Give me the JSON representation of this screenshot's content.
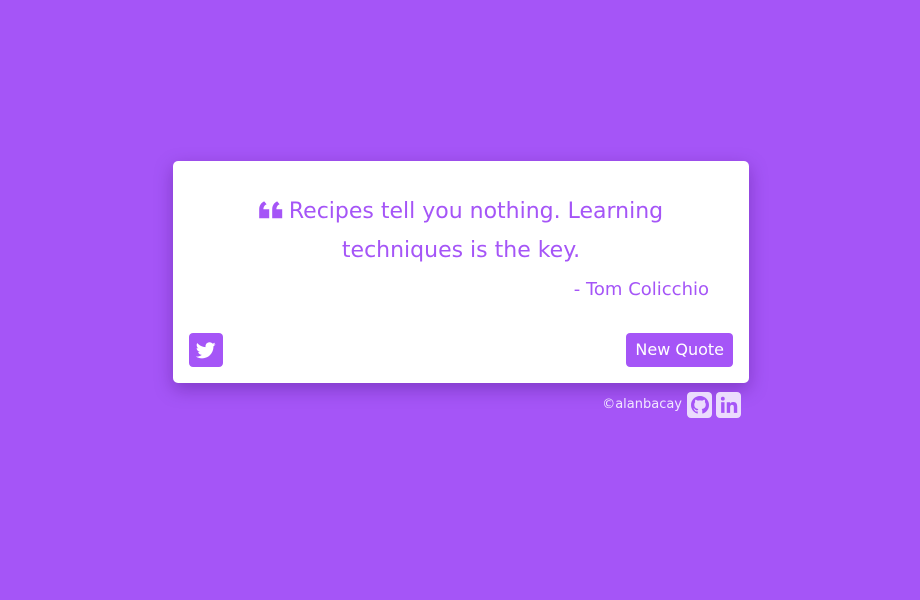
{
  "colors": {
    "background": "#a555f7",
    "card": "#ffffff",
    "accent": "#a555f7",
    "footer_text": "#f1e6ff",
    "social_tile": "#ebdcfd"
  },
  "quote": {
    "icon": "quote-left-icon",
    "text": "Recipes tell you nothing. Learning techniques is the key.",
    "author": "- Tom Colicchio"
  },
  "actions": {
    "tweet_icon": "twitter-icon",
    "new_quote_label": "New Quote"
  },
  "footer": {
    "credit": "©alanbacay",
    "links": [
      {
        "icon": "github-icon"
      },
      {
        "icon": "linkedin-icon"
      }
    ]
  }
}
